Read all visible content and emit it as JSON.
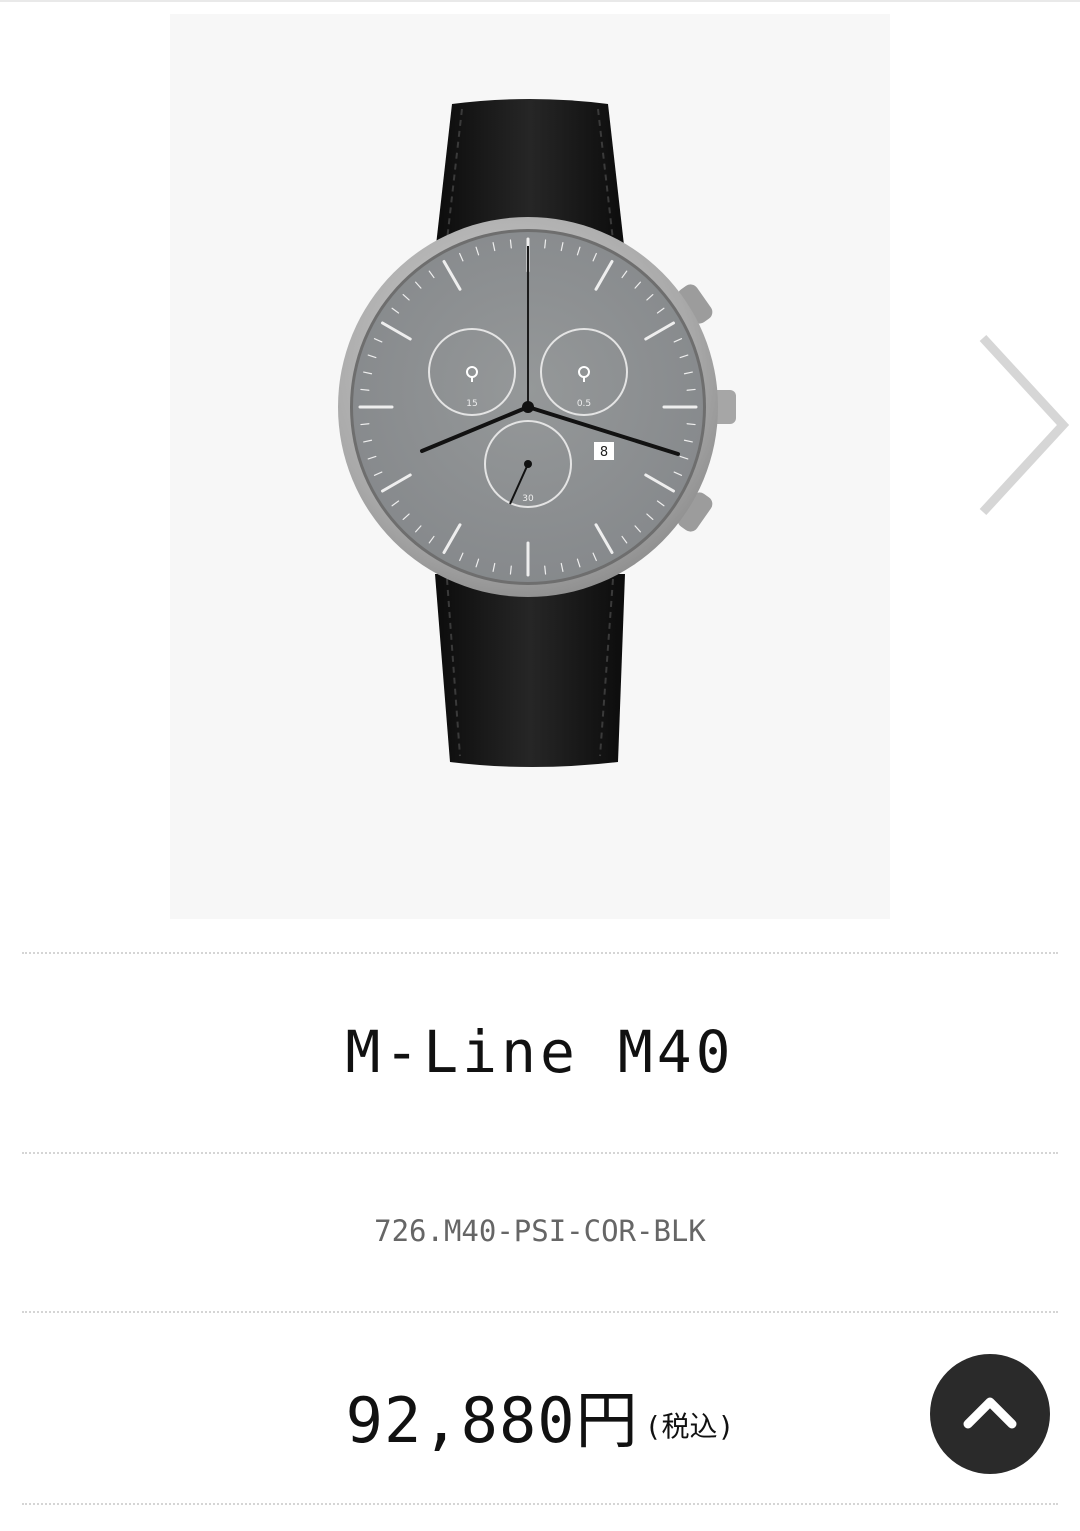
{
  "product": {
    "name": "M-Line M40",
    "sku": "726.M40-PSI-COR-BLK",
    "price": "92,880円",
    "price_note": "(税込)"
  },
  "watch_dial": {
    "subdial_left_label": "15",
    "subdial_right_label": "0.5",
    "subdial_bottom_label": "30",
    "date": "8"
  },
  "colors": {
    "dial": "#8c8f92",
    "strap": "#151515",
    "case": "#b4b4b4",
    "back_to_top_bg": "#2a2a2a"
  },
  "icons": {
    "next": "chevron-right-icon",
    "back_to_top": "chevron-up-icon"
  }
}
